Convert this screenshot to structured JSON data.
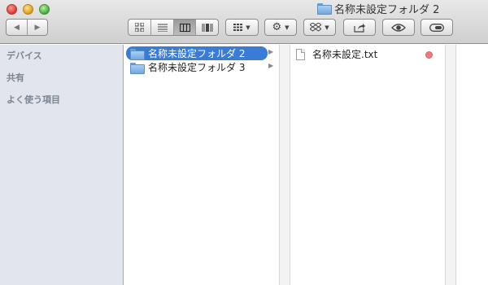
{
  "window": {
    "title": "名称未設定フォルダ 2"
  },
  "toolbar": {
    "back_icon": "back-arrow-icon",
    "forward_icon": "forward-arrow-icon",
    "view_modes": [
      "icon-view",
      "list-view",
      "column-view",
      "coverflow-view"
    ],
    "active_view": "column-view"
  },
  "sidebar": {
    "sections": [
      "デバイス",
      "共有",
      "よく使う項目"
    ]
  },
  "columns": {
    "first": [
      {
        "label": "名称未設定フォルダ 2",
        "selected": true
      },
      {
        "label": "名称未設定フォルダ 3",
        "selected": false
      }
    ],
    "second": [
      {
        "label": "名称未設定.txt",
        "tag_color": "#f27a7a"
      }
    ]
  },
  "colors": {
    "selection": "#3a7bd5",
    "sidebar_bg": "#e2e6ec"
  }
}
